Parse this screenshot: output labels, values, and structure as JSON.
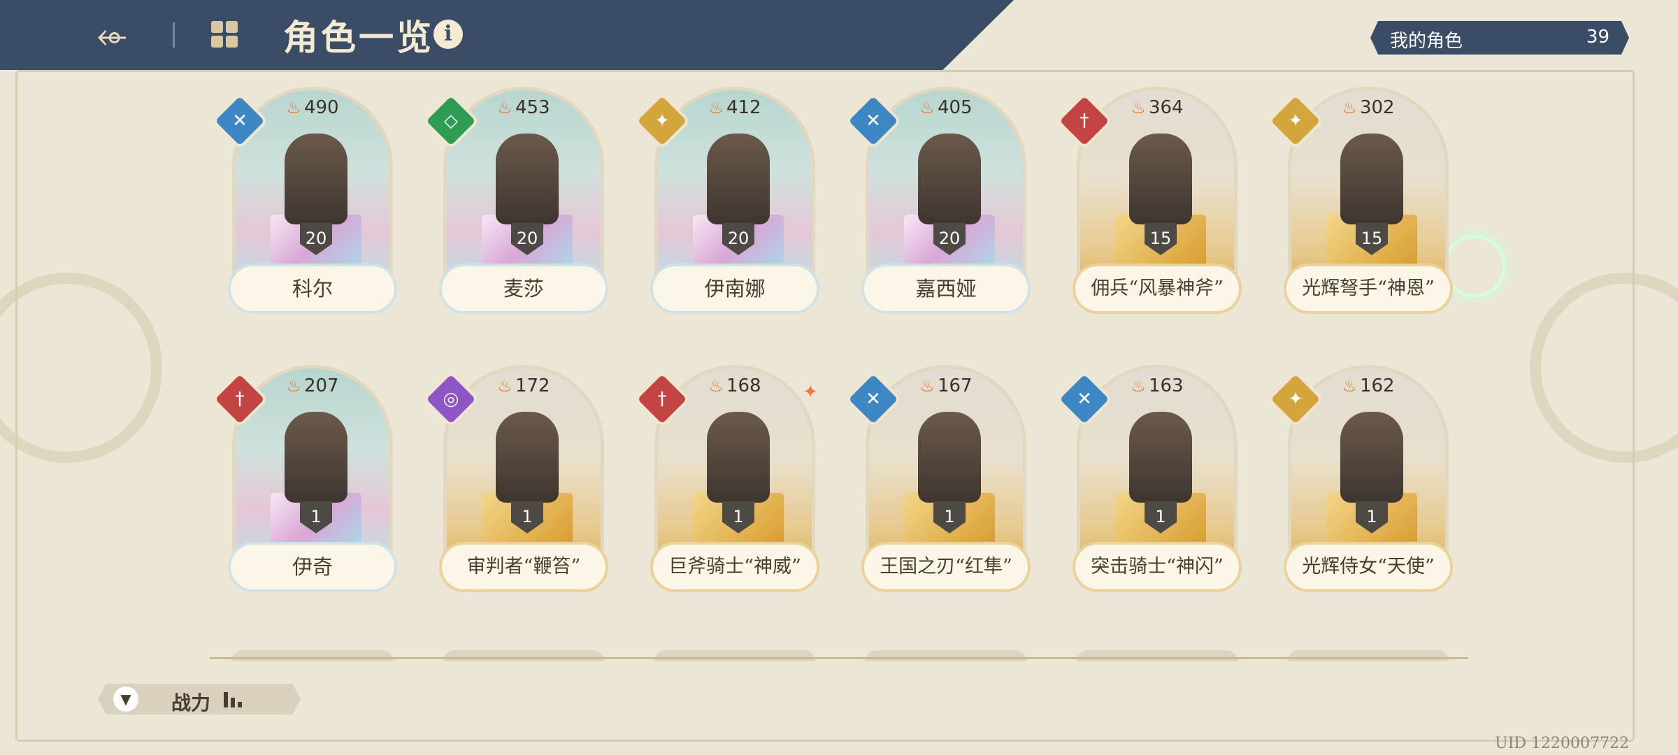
{
  "header": {
    "back_icon": "back-arrow-icon",
    "grid_icon": "grid-icon",
    "title": "角色一览",
    "info_label": "i"
  },
  "roster": {
    "label": "我的角色",
    "count": "39"
  },
  "cards": [
    {
      "power": "490",
      "level": "20",
      "stars": "★",
      "name": "科尔",
      "frame": "rainbow",
      "badge": "blue",
      "glyph": "✕"
    },
    {
      "power": "453",
      "level": "20",
      "stars": "★",
      "name": "麦莎",
      "frame": "rainbow",
      "badge": "green",
      "glyph": "◇"
    },
    {
      "power": "412",
      "level": "20",
      "stars": "★",
      "name": "伊南娜",
      "frame": "rainbow",
      "badge": "gold",
      "glyph": "✦"
    },
    {
      "power": "405",
      "level": "20",
      "stars": "★",
      "name": "嘉西娅",
      "frame": "rainbow",
      "badge": "blue",
      "glyph": "✕"
    },
    {
      "power": "364",
      "level": "15",
      "stars": "★★★",
      "name": "佣兵“风暴神斧”",
      "frame": "gold",
      "badge": "red",
      "glyph": "†"
    },
    {
      "power": "302",
      "level": "15",
      "stars": "★",
      "name": "光辉弩手“神恩”",
      "frame": "gold",
      "badge": "gold",
      "glyph": "✦"
    },
    {
      "power": "207",
      "level": "1",
      "stars": "★",
      "name": "伊奇",
      "frame": "rainbow",
      "badge": "red",
      "glyph": "†"
    },
    {
      "power": "172",
      "level": "1",
      "stars": "★★★",
      "name": "审判者“鞭笞”",
      "frame": "gold",
      "badge": "purple",
      "glyph": "◎"
    },
    {
      "power": "168",
      "level": "1",
      "stars": "★★",
      "name": "巨斧骑士“神威”",
      "frame": "gold",
      "badge": "red",
      "glyph": "†"
    },
    {
      "power": "167",
      "level": "1",
      "stars": "★★",
      "name": "王国之刃“红隼”",
      "frame": "gold",
      "badge": "blue",
      "glyph": "✕"
    },
    {
      "power": "163",
      "level": "1",
      "stars": "★",
      "name": "突击骑士“神闪”",
      "frame": "gold",
      "badge": "blue",
      "glyph": "✕"
    },
    {
      "power": "162",
      "level": "1",
      "stars": "★★★",
      "name": "光辉侍女“天使”",
      "frame": "gold",
      "badge": "gold",
      "glyph": "✦"
    }
  ],
  "sort": {
    "icon": "funnel-icon",
    "label": "战力"
  },
  "uid": "UID 1220007722",
  "colors": {
    "header": "#3b4c66",
    "background": "#ece6d6",
    "flame": "#e0752a"
  }
}
